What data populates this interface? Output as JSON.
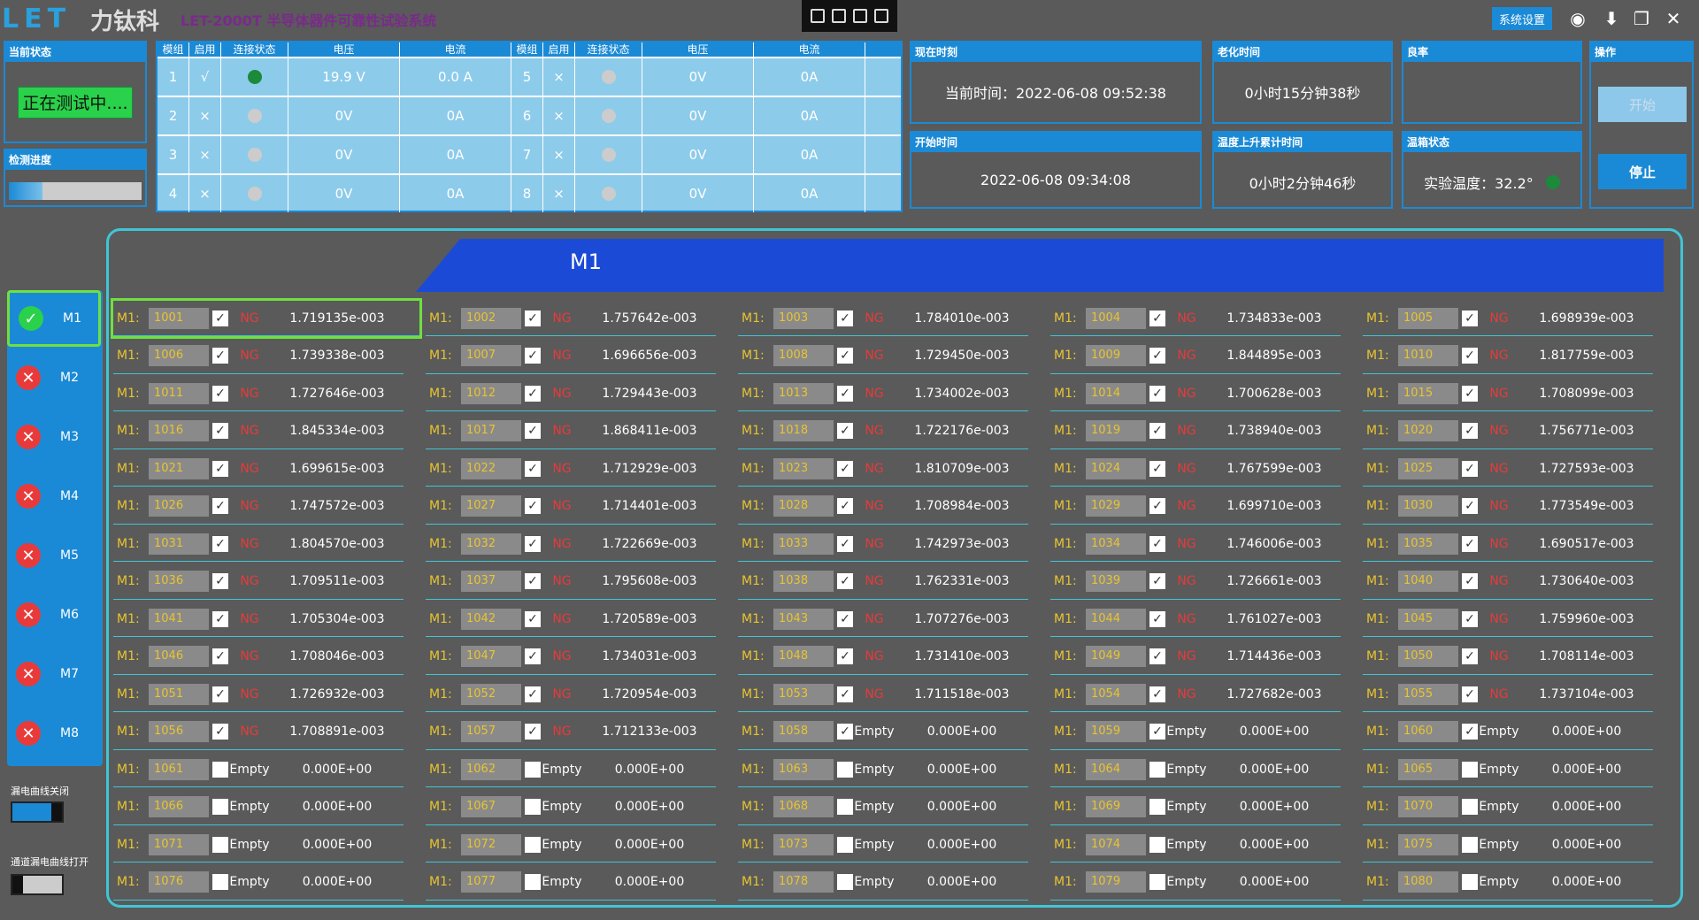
{
  "app": {
    "logo": "LET",
    "logo_cn": "力钛科",
    "title": "LET-2000T 半导体器件可靠性试验系统",
    "sys_settings": "系统设置"
  },
  "status": {
    "header": "当前状态",
    "text": "正在测试中....",
    "progress_header": "检测进度",
    "progress": 0.25
  },
  "modules": {
    "headers": [
      "模组",
      "启用",
      "连接状态",
      "电压",
      "电流",
      "模组",
      "启用",
      "连接状态",
      "电压",
      "电流"
    ],
    "rows": [
      [
        "1",
        "√",
        true,
        "19.9 V",
        "0.0 A",
        "5",
        "×",
        false,
        "0V",
        "0A"
      ],
      [
        "2",
        "×",
        false,
        "0V",
        "0A",
        "6",
        "×",
        false,
        "0V",
        "0A"
      ],
      [
        "3",
        "×",
        false,
        "0V",
        "0A",
        "7",
        "×",
        false,
        "0V",
        "0A"
      ],
      [
        "4",
        "×",
        false,
        "0V",
        "0A",
        "8",
        "×",
        false,
        "0V",
        "0A"
      ]
    ]
  },
  "info": {
    "now_hdr": "现在时刻",
    "now": "当前时间：2022-06-08 09:52:38",
    "aging_hdr": "老化时间",
    "aging": "0小时15分钟38秒",
    "yield_hdr": "良率",
    "op_hdr": "操作",
    "start_hdr": "开始时间",
    "start": "2022-06-08 09:34:08",
    "rise_hdr": "温度上升累计时间",
    "rise": "0小时2分钟46秒",
    "temp_hdr": "温箱状态",
    "temp": "实验温度：32.2°",
    "btn_start": "开始",
    "btn_stop": "停止"
  },
  "banner": "M1",
  "side": [
    {
      "label": "M1",
      "ok": true
    },
    {
      "label": "M2",
      "ok": false
    },
    {
      "label": "M3",
      "ok": false
    },
    {
      "label": "M4",
      "ok": false
    },
    {
      "label": "M5",
      "ok": false
    },
    {
      "label": "M6",
      "ok": false
    },
    {
      "label": "M7",
      "ok": false
    },
    {
      "label": "M8",
      "ok": false
    }
  ],
  "bottom": {
    "leak_close": "漏电曲线关闭",
    "channel_leak_open": "通道漏电曲线打开"
  },
  "cells": [
    [
      "1001",
      true,
      "NG",
      "1.719135e-003"
    ],
    [
      "1002",
      true,
      "NG",
      "1.757642e-003"
    ],
    [
      "1003",
      true,
      "NG",
      "1.784010e-003"
    ],
    [
      "1004",
      true,
      "NG",
      "1.734833e-003"
    ],
    [
      "1005",
      true,
      "NG",
      "1.698939e-003"
    ],
    [
      "1006",
      true,
      "NG",
      "1.739338e-003"
    ],
    [
      "1007",
      true,
      "NG",
      "1.696656e-003"
    ],
    [
      "1008",
      true,
      "NG",
      "1.729450e-003"
    ],
    [
      "1009",
      true,
      "NG",
      "1.844895e-003"
    ],
    [
      "1010",
      true,
      "NG",
      "1.817759e-003"
    ],
    [
      "1011",
      true,
      "NG",
      "1.727646e-003"
    ],
    [
      "1012",
      true,
      "NG",
      "1.729443e-003"
    ],
    [
      "1013",
      true,
      "NG",
      "1.734002e-003"
    ],
    [
      "1014",
      true,
      "NG",
      "1.700628e-003"
    ],
    [
      "1015",
      true,
      "NG",
      "1.708099e-003"
    ],
    [
      "1016",
      true,
      "NG",
      "1.845334e-003"
    ],
    [
      "1017",
      true,
      "NG",
      "1.868411e-003"
    ],
    [
      "1018",
      true,
      "NG",
      "1.722176e-003"
    ],
    [
      "1019",
      true,
      "NG",
      "1.738940e-003"
    ],
    [
      "1020",
      true,
      "NG",
      "1.756771e-003"
    ],
    [
      "1021",
      true,
      "NG",
      "1.699615e-003"
    ],
    [
      "1022",
      true,
      "NG",
      "1.712929e-003"
    ],
    [
      "1023",
      true,
      "NG",
      "1.810709e-003"
    ],
    [
      "1024",
      true,
      "NG",
      "1.767599e-003"
    ],
    [
      "1025",
      true,
      "NG",
      "1.727593e-003"
    ],
    [
      "1026",
      true,
      "NG",
      "1.747572e-003"
    ],
    [
      "1027",
      true,
      "NG",
      "1.714401e-003"
    ],
    [
      "1028",
      true,
      "NG",
      "1.708984e-003"
    ],
    [
      "1029",
      true,
      "NG",
      "1.699710e-003"
    ],
    [
      "1030",
      true,
      "NG",
      "1.773549e-003"
    ],
    [
      "1031",
      true,
      "NG",
      "1.804570e-003"
    ],
    [
      "1032",
      true,
      "NG",
      "1.722669e-003"
    ],
    [
      "1033",
      true,
      "NG",
      "1.742973e-003"
    ],
    [
      "1034",
      true,
      "NG",
      "1.746006e-003"
    ],
    [
      "1035",
      true,
      "NG",
      "1.690517e-003"
    ],
    [
      "1036",
      true,
      "NG",
      "1.709511e-003"
    ],
    [
      "1037",
      true,
      "NG",
      "1.795608e-003"
    ],
    [
      "1038",
      true,
      "NG",
      "1.762331e-003"
    ],
    [
      "1039",
      true,
      "NG",
      "1.726661e-003"
    ],
    [
      "1040",
      true,
      "NG",
      "1.730640e-003"
    ],
    [
      "1041",
      true,
      "NG",
      "1.705304e-003"
    ],
    [
      "1042",
      true,
      "NG",
      "1.720589e-003"
    ],
    [
      "1043",
      true,
      "NG",
      "1.707276e-003"
    ],
    [
      "1044",
      true,
      "NG",
      "1.761027e-003"
    ],
    [
      "1045",
      true,
      "NG",
      "1.759960e-003"
    ],
    [
      "1046",
      true,
      "NG",
      "1.708046e-003"
    ],
    [
      "1047",
      true,
      "NG",
      "1.734031e-003"
    ],
    [
      "1048",
      true,
      "NG",
      "1.731410e-003"
    ],
    [
      "1049",
      true,
      "NG",
      "1.714436e-003"
    ],
    [
      "1050",
      true,
      "NG",
      "1.708114e-003"
    ],
    [
      "1051",
      true,
      "NG",
      "1.726932e-003"
    ],
    [
      "1052",
      true,
      "NG",
      "1.720954e-003"
    ],
    [
      "1053",
      true,
      "NG",
      "1.711518e-003"
    ],
    [
      "1054",
      true,
      "NG",
      "1.727682e-003"
    ],
    [
      "1055",
      true,
      "NG",
      "1.737104e-003"
    ],
    [
      "1056",
      true,
      "NG",
      "1.708891e-003"
    ],
    [
      "1057",
      true,
      "NG",
      "1.712133e-003"
    ],
    [
      "1058",
      true,
      "Empty",
      "0.000E+00"
    ],
    [
      "1059",
      true,
      "Empty",
      "0.000E+00"
    ],
    [
      "1060",
      true,
      "Empty",
      "0.000E+00"
    ],
    [
      "1061",
      false,
      "Empty",
      "0.000E+00"
    ],
    [
      "1062",
      false,
      "Empty",
      "0.000E+00"
    ],
    [
      "1063",
      false,
      "Empty",
      "0.000E+00"
    ],
    [
      "1064",
      false,
      "Empty",
      "0.000E+00"
    ],
    [
      "1065",
      false,
      "Empty",
      "0.000E+00"
    ],
    [
      "1066",
      false,
      "Empty",
      "0.000E+00"
    ],
    [
      "1067",
      false,
      "Empty",
      "0.000E+00"
    ],
    [
      "1068",
      false,
      "Empty",
      "0.000E+00"
    ],
    [
      "1069",
      false,
      "Empty",
      "0.000E+00"
    ],
    [
      "1070",
      false,
      "Empty",
      "0.000E+00"
    ],
    [
      "1071",
      false,
      "Empty",
      "0.000E+00"
    ],
    [
      "1072",
      false,
      "Empty",
      "0.000E+00"
    ],
    [
      "1073",
      false,
      "Empty",
      "0.000E+00"
    ],
    [
      "1074",
      false,
      "Empty",
      "0.000E+00"
    ],
    [
      "1075",
      false,
      "Empty",
      "0.000E+00"
    ],
    [
      "1076",
      false,
      "Empty",
      "0.000E+00"
    ],
    [
      "1077",
      false,
      "Empty",
      "0.000E+00"
    ],
    [
      "1078",
      false,
      "Empty",
      "0.000E+00"
    ],
    [
      "1079",
      false,
      "Empty",
      "0.000E+00"
    ],
    [
      "1080",
      false,
      "Empty",
      "0.000E+00"
    ]
  ],
  "cell_prefix": "M1:"
}
